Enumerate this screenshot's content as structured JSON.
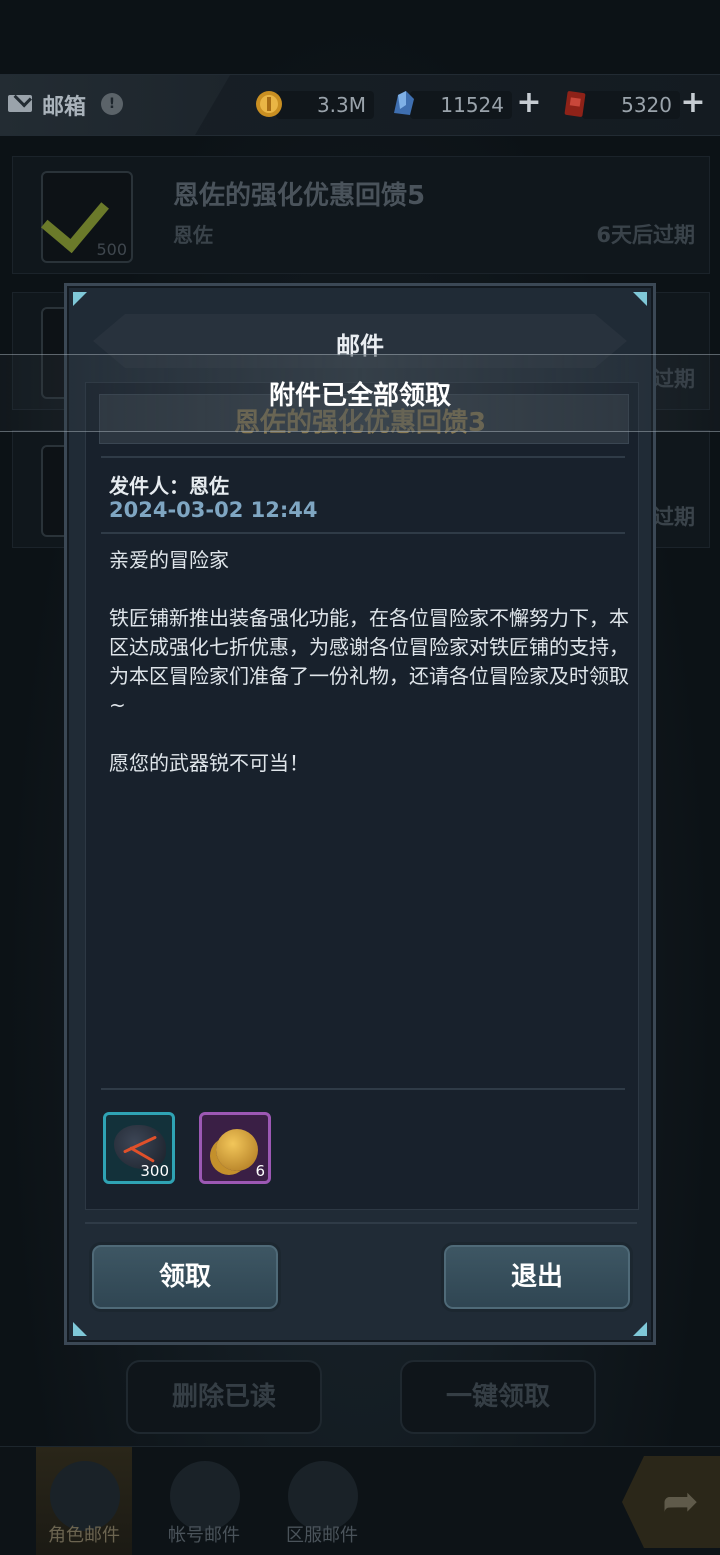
{
  "topbar": {
    "title": "邮箱",
    "currencies": [
      {
        "icon": "gold-coin-icon",
        "value": "3.3M"
      },
      {
        "icon": "blue-crystal-icon",
        "value": "11524"
      },
      {
        "icon": "red-ticket-icon",
        "value": "5320"
      }
    ]
  },
  "mail_list": {
    "items": [
      {
        "title": "恩佐的强化优惠回馈5",
        "sender": "恩佐",
        "expiry": "6天后过期",
        "thumb_count": "500"
      },
      {
        "expiry": "过期"
      },
      {
        "expiry": "过期"
      }
    ],
    "delete_read_label": "删除已读",
    "claim_all_label": "一键领取"
  },
  "bottom_nav": {
    "tabs": [
      {
        "label": "角色邮件"
      },
      {
        "label": "帐号邮件"
      },
      {
        "label": "区服邮件"
      }
    ]
  },
  "modal": {
    "title": "邮件",
    "subject": "恩佐的强化优惠回馈3",
    "sender_line": "发件人：恩佐",
    "date": "2024-03-02 12:44",
    "body": "亲爱的冒险家\n\n铁匠铺新推出装备强化功能，在各位冒险家不懈努力下，本区达成强化七折优惠，为感谢各位冒险家对铁匠铺的支持，为本区冒险家们准备了一份礼物，还请各位冒险家及时领取~\n\n愿您的武器锐不可当！",
    "attachments": [
      {
        "icon": "lava-ore-icon",
        "count": "300"
      },
      {
        "icon": "gold-coins-icon",
        "count": "6"
      }
    ],
    "claim_label": "领取",
    "exit_label": "退出"
  },
  "toast": {
    "text": "附件已全部领取"
  }
}
